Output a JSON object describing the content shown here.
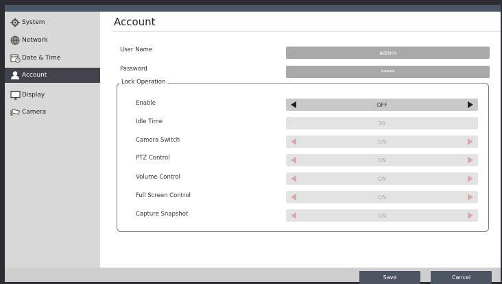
{
  "sidebar": {
    "items": [
      {
        "label": "System",
        "icon": "gear-icon"
      },
      {
        "label": "Network",
        "icon": "globe-icon"
      },
      {
        "label": "Date & Time",
        "icon": "calendar-clock-icon"
      },
      {
        "label": "Account",
        "icon": "user-icon",
        "active": true
      },
      {
        "label": "Display",
        "icon": "monitor-icon"
      },
      {
        "label": "Camera",
        "icon": "camera-icon"
      }
    ]
  },
  "main": {
    "title": "Account",
    "user_name": {
      "label": "User Name",
      "value": "admin"
    },
    "password": {
      "label": "Password",
      "value": "*****"
    },
    "lock": {
      "legend": "Lock Operation",
      "enable": {
        "label": "Enable",
        "value": "OFF"
      },
      "idle_time": {
        "label": "Idle Time",
        "value": "30"
      },
      "camera_switch": {
        "label": "Camera Switch",
        "value": "ON"
      },
      "ptz_control": {
        "label": "PTZ Control",
        "value": "ON"
      },
      "volume_control": {
        "label": "Volume Control",
        "value": "ON"
      },
      "full_screen_control": {
        "label": "Full Screen Control",
        "value": "ON"
      },
      "capture_snapshot": {
        "label": "Capture Snapshot",
        "value": "ON"
      }
    }
  },
  "footer": {
    "save_label": "Save",
    "cancel_label": "Cancel"
  },
  "colors": {
    "active_sidebar": "#404349",
    "button": "#4e5562",
    "disabled_arrow": "#d8a8ad"
  }
}
